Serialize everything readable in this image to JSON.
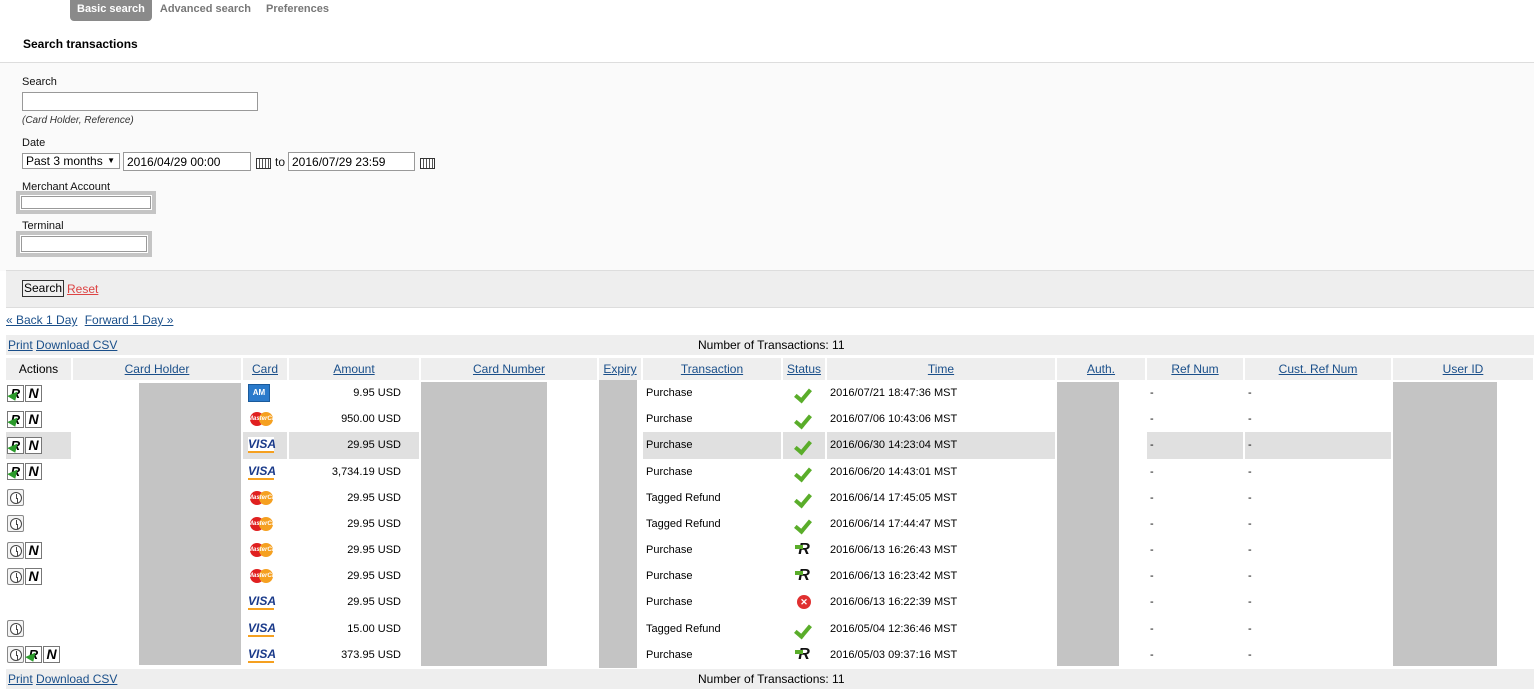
{
  "tabs": [
    {
      "label": "Basic search",
      "active": true
    },
    {
      "label": "Advanced search",
      "active": false
    },
    {
      "label": "Preferences",
      "active": false
    }
  ],
  "page_title": "Search transactions",
  "form": {
    "search_label": "Search",
    "search_value": "",
    "search_hint": "(Card Holder, Reference)",
    "date_label": "Date",
    "date_range_select": "Past 3 months",
    "date_from": "2016/04/29 00:00",
    "date_to_label": "to",
    "date_to": "2016/07/29 23:59",
    "merchant_label": "Merchant Account",
    "merchant_value": "",
    "terminal_label": "Terminal",
    "terminal_value": "",
    "search_button": "Search",
    "reset_link": "Reset"
  },
  "nav": {
    "back": "« Back 1 Day",
    "forward": "Forward 1 Day »"
  },
  "toolbar": {
    "print": "Print",
    "download_csv": "Download CSV",
    "count_text": "Number of Transactions: 11"
  },
  "table": {
    "headers": {
      "actions": "Actions",
      "card_holder": "Card Holder",
      "card": "Card",
      "amount": "Amount",
      "card_number": "Card Number",
      "expiry": "Expiry",
      "transaction": "Transaction",
      "status": "Status",
      "time": "Time",
      "auth": "Auth.",
      "ref_num": "Ref Num",
      "cust_ref_num": "Cust. Ref Num",
      "user_id": "User ID"
    },
    "rows": [
      {
        "actions": [
          "refund-icon",
          "void-icon"
        ],
        "card": "amex",
        "amount": "9.95 USD",
        "transaction": "Purchase",
        "status": "approved",
        "time": "2016/07/21 18:47:36 MST",
        "ref_num": "-",
        "cust_ref_num": "-"
      },
      {
        "actions": [
          "refund-icon",
          "void-icon"
        ],
        "card": "mastercard",
        "amount": "950.00 USD",
        "transaction": "Purchase",
        "status": "approved",
        "time": "2016/07/06 10:43:06 MST",
        "ref_num": "-",
        "cust_ref_num": "-"
      },
      {
        "actions": [
          "refund-icon",
          "void-icon"
        ],
        "card": "visa",
        "amount": "29.95 USD",
        "transaction": "Purchase",
        "status": "approved",
        "time": "2016/06/30 14:23:04 MST",
        "ref_num": "-",
        "cust_ref_num": "-",
        "highlight": true
      },
      {
        "actions": [
          "refund-icon",
          "void-icon"
        ],
        "card": "visa",
        "amount": "3,734.19 USD",
        "transaction": "Purchase",
        "status": "approved",
        "time": "2016/06/20 14:43:01 MST",
        "ref_num": "-",
        "cust_ref_num": "-"
      },
      {
        "actions": [
          "history-icon"
        ],
        "card": "mastercard",
        "amount": "29.95 USD",
        "transaction": "Tagged Refund",
        "status": "approved",
        "time": "2016/06/14 17:45:05 MST",
        "ref_num": "-",
        "cust_ref_num": "-"
      },
      {
        "actions": [
          "history-icon"
        ],
        "card": "mastercard",
        "amount": "29.95 USD",
        "transaction": "Tagged Refund",
        "status": "approved",
        "time": "2016/06/14 17:44:47 MST",
        "ref_num": "-",
        "cust_ref_num": "-"
      },
      {
        "actions": [
          "history-icon",
          "void-icon"
        ],
        "card": "mastercard",
        "amount": "29.95 USD",
        "transaction": "Purchase",
        "status": "refunded",
        "time": "2016/06/13 16:26:43 MST",
        "ref_num": "-",
        "cust_ref_num": "-"
      },
      {
        "actions": [
          "history-icon",
          "void-icon"
        ],
        "card": "mastercard",
        "amount": "29.95 USD",
        "transaction": "Purchase",
        "status": "refunded",
        "time": "2016/06/13 16:23:42 MST",
        "ref_num": "-",
        "cust_ref_num": "-"
      },
      {
        "actions": [],
        "card": "visa",
        "amount": "29.95 USD",
        "transaction": "Purchase",
        "status": "declined",
        "time": "2016/06/13 16:22:39 MST",
        "ref_num": "-",
        "cust_ref_num": "-"
      },
      {
        "actions": [
          "history-icon"
        ],
        "card": "visa",
        "amount": "15.00 USD",
        "transaction": "Tagged Refund",
        "status": "approved",
        "time": "2016/05/04 12:36:46 MST",
        "ref_num": "-",
        "cust_ref_num": "-"
      },
      {
        "actions": [
          "history-icon",
          "refund-icon",
          "void-icon"
        ],
        "card": "visa",
        "amount": "373.95 USD",
        "transaction": "Purchase",
        "status": "refunded",
        "time": "2016/05/03 09:37:16 MST",
        "ref_num": "-",
        "cust_ref_num": "-"
      }
    ]
  },
  "colors": {
    "link": "#1a4f8a",
    "reset": "#dd4444",
    "approved": "#5aad2a",
    "declined": "#e03030",
    "redacted": "#c4c4c4"
  }
}
